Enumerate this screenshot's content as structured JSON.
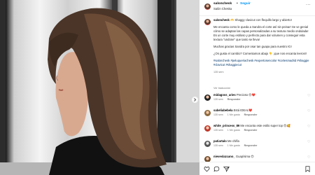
{
  "post": {
    "username": "salonchesk",
    "separator": "•",
    "follow_label": "Seguir",
    "subtitle": "Salón Cheska",
    "more_label": "···"
  },
  "caption": {
    "username": "salonchesk",
    "text1": "🫶 Shaggy clavicut con flequillo largo y abierto!",
    "text2": "Me encanta como le queda a Sandra el corte así sin peinar! Se ve genial cómo se adaptan las capas personalizadas a su textura medio ondulada! Es un corte muy estiloso y perfecto para dar volumen y conseguir esta textura \"undone\" que tanto se lleva!",
    "text3": "Muchas gracias Sandra por osar tan guapa para nuestro IG!",
    "text4": "¿Os gusta el cambio? Comentamos abajo 👇 ¡que nos encanta leeros!!",
    "hashtags": "#salonchesk #peluqueriachesk #expertosencolor #cortesmadrid #shaggie #clavicut #shaggiecut",
    "time": "135 sem"
  },
  "translate_label": "Ver traducción",
  "comments": [
    {
      "user": "midagoss_aries",
      "text": "Precioso 😍❤️",
      "time": "135 sem",
      "likes": "",
      "reply": "Responder"
    },
    {
      "user": "sabeliabebela",
      "text": "Está IDEAL❤️",
      "time": "135 sem",
      "likes": "1 Me gusta",
      "reply": "Responder"
    },
    {
      "user": "white_princess_89",
      "text": "Me encanta este estilo super top 😍🥰",
      "time": "135 sem",
      "likes": "1 Me gusta",
      "reply": "Responder"
    },
    {
      "user": "patiartalo",
      "text": "Me chifla",
      "time": "135 sem",
      "likes": "1 Me gusta",
      "reply": "Responder"
    },
    {
      "user": "nieveslazcano_",
      "text": "Guapísima 😍",
      "time": "135 sem",
      "likes": "",
      "reply": "Responder"
    }
  ],
  "icons": {
    "like": "heart-icon",
    "comment": "comment-icon",
    "share": "share-icon",
    "save": "bookmark-icon",
    "next": "chevron-right-icon"
  }
}
